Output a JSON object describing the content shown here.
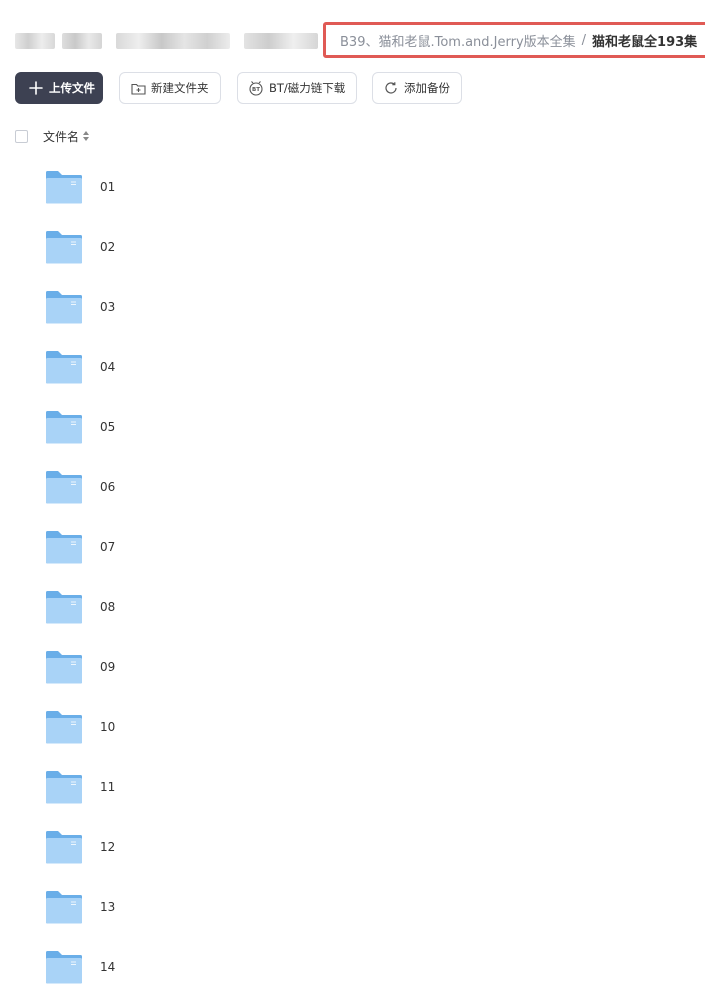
{
  "breadcrumb": {
    "parent": "B39、猫和老鼠.Tom.and.Jerry版本全集",
    "separator": "/",
    "current": "猫和老鼠全193集"
  },
  "toolbar": {
    "upload": {
      "label": "上传文件",
      "icon": "plus-icon"
    },
    "new_folder": {
      "label": "新建文件夹",
      "icon": "new-folder-icon"
    },
    "bt_download": {
      "label": "BT/磁力链下载",
      "icon": "bt-icon"
    },
    "add_backup": {
      "label": "添加备份",
      "icon": "sync-icon"
    }
  },
  "list_header": {
    "label": "文件名",
    "sort_icon": "sort-icon"
  },
  "folders": [
    "01",
    "02",
    "03",
    "04",
    "05",
    "06",
    "07",
    "08",
    "09",
    "10",
    "11",
    "12",
    "13",
    "14"
  ],
  "colors": {
    "highlight_border": "#e05a55",
    "primary_button": "#3d4152",
    "folder_back": "#6aaee8",
    "folder_front": "#a9d3f7"
  }
}
